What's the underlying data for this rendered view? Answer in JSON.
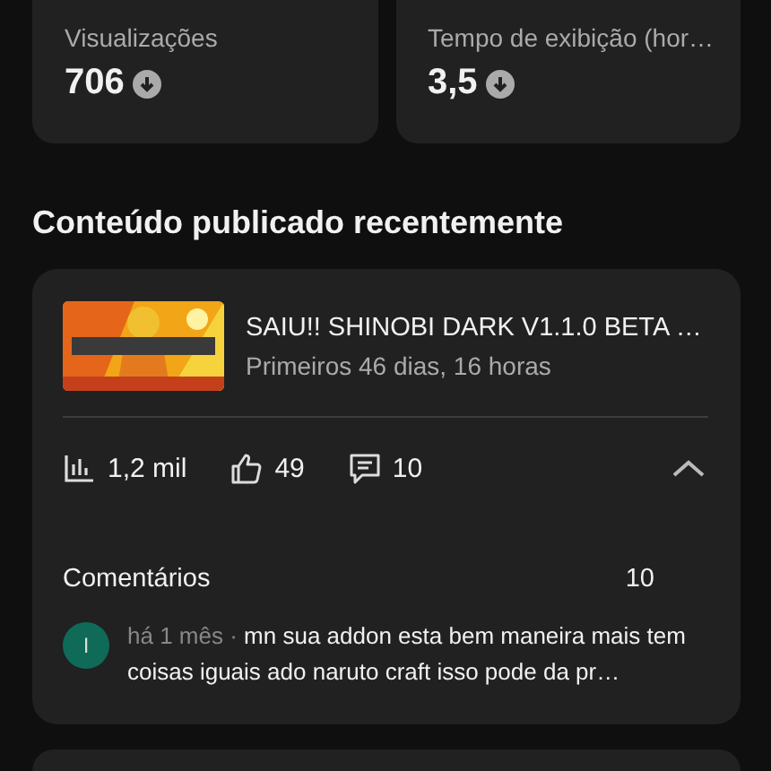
{
  "stats": [
    {
      "label": "Visualizações",
      "value": "706",
      "declining": true
    },
    {
      "label": "Tempo de exibição (hor…",
      "value": "3,5",
      "declining": true
    }
  ],
  "section_title": "Conteúdo publicado recentemente",
  "video": {
    "title": "SAIU!! SHINOBI DARK V1.1.0 BETA …",
    "subtitle": "Primeiros 46 dias, 16 horas",
    "metrics": [
      {
        "kind": "views",
        "value": "1,2 mil"
      },
      {
        "kind": "likes",
        "value": "49"
      },
      {
        "kind": "comments",
        "value": "10"
      }
    ],
    "expanded": true,
    "comments_label": "Comentários",
    "comments_count": "10",
    "comment": {
      "avatar": "I",
      "color": "#0f6b57",
      "age": "há 1 mês ·",
      "text": "mn sua addon esta bem maneira mais tem coisas iguais ado naruto craft isso pode da pr…"
    }
  }
}
